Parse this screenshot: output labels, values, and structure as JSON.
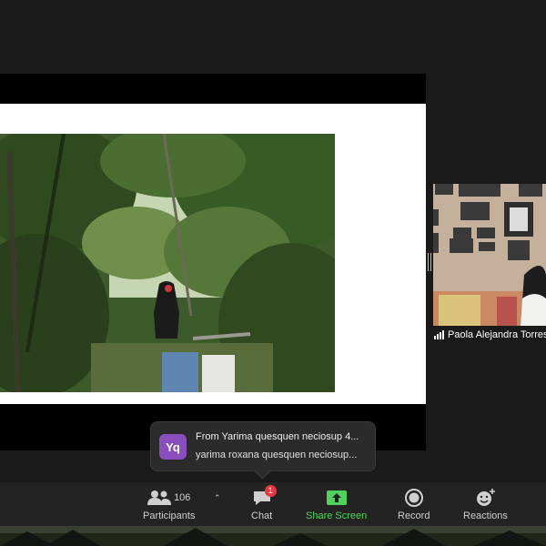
{
  "participant": {
    "name": "Paola Alejandra Torres"
  },
  "chat_preview": {
    "avatar_initials": "Yq",
    "from_line": "From Yarima quesquen neciosup 4...",
    "message": "yarima roxana quesquen neciosup..."
  },
  "toolbar": {
    "participants_label": "Participants",
    "participants_count": "106",
    "chat_label": "Chat",
    "chat_badge": "1",
    "share_label": "Share Screen",
    "record_label": "Record",
    "reactions_label": "Reactions"
  },
  "icons": {
    "participants": "participants-icon",
    "chat": "chat-icon",
    "share": "share-screen-icon",
    "record": "record-icon",
    "reactions": "reactions-icon",
    "signal": "signal-strength-icon"
  },
  "colors": {
    "share_green": "#4fd25c",
    "badge_red": "#e5393d",
    "avatar_purple": "#8a4fbf",
    "toolbar_bg": "#232323"
  }
}
